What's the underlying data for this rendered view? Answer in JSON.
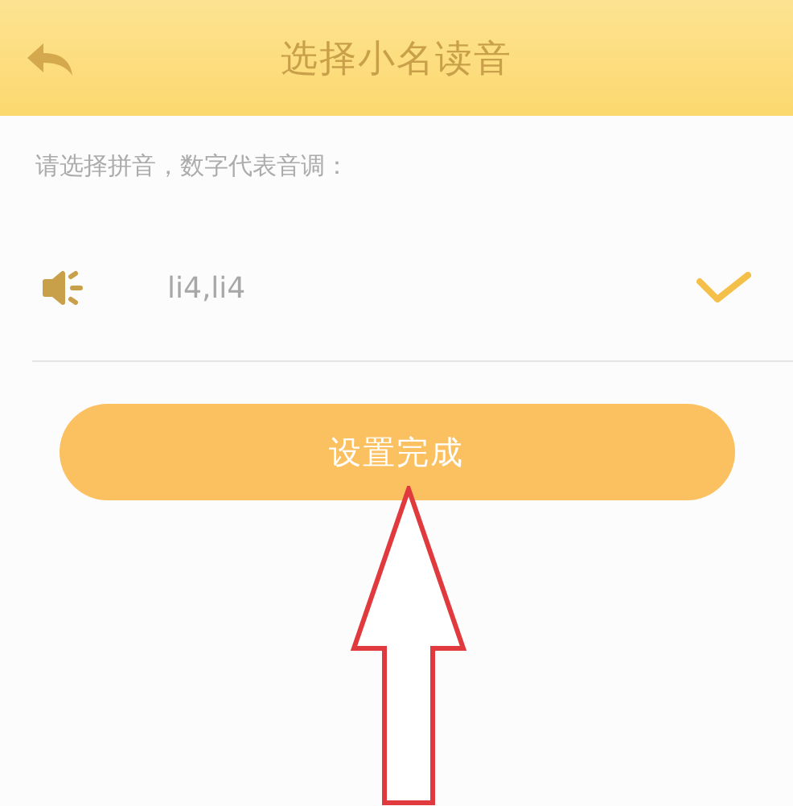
{
  "header": {
    "title": "选择小名读音"
  },
  "instruction": "请选择拼音，数字代表音调：",
  "options": [
    {
      "label": "li4,li4",
      "selected": true
    }
  ],
  "button": {
    "label": "设置完成"
  },
  "annotation": {
    "kind": "arrow"
  }
}
